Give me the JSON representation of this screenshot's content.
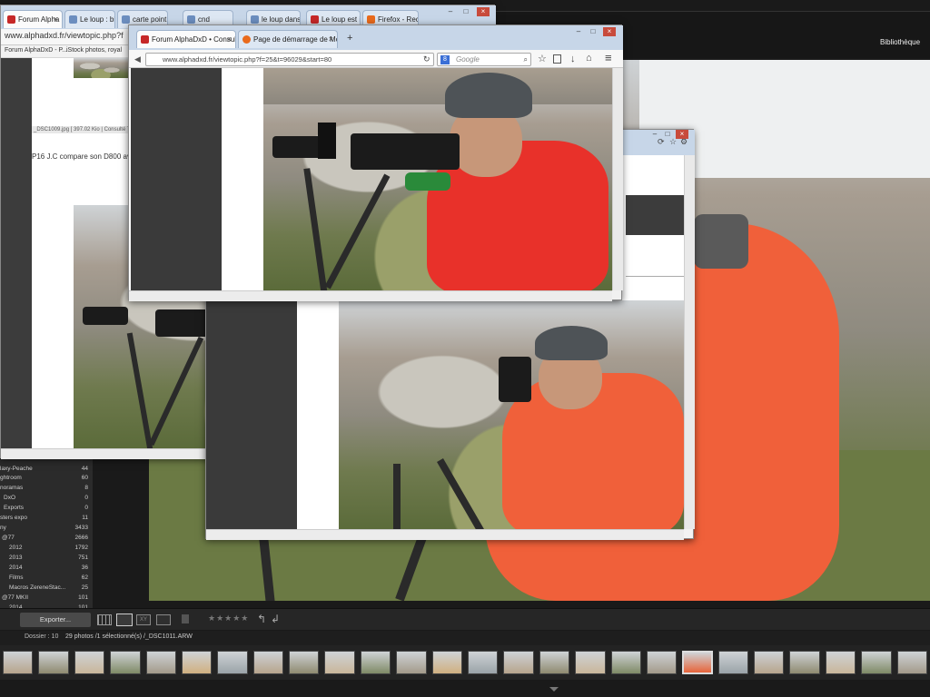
{
  "lightroom": {
    "module_label": "Bibliothèque",
    "export_button": "Exporter...",
    "rating_stars": "★★★★★",
    "source_label": "Dossier : 10",
    "photo_count": "29 photos /1 sélectionné(s) /_DSC1011.ARW",
    "folders": [
      {
        "name": "laxy-Peache",
        "count": "44"
      },
      {
        "name": "ghtroom",
        "count": "60"
      },
      {
        "name": "noramas",
        "count": "8"
      },
      {
        "name": "DxO",
        "count": "0"
      },
      {
        "name": "Exports",
        "count": "0"
      },
      {
        "name": "sters expo",
        "count": "11"
      },
      {
        "name": "ny",
        "count": "3433"
      },
      {
        "name": "@77",
        "count": "2666"
      },
      {
        "name": "2012",
        "count": "1792"
      },
      {
        "name": "2013",
        "count": "751"
      },
      {
        "name": "2014",
        "count": "36"
      },
      {
        "name": "Films",
        "count": "62"
      },
      {
        "name": "Macros ZereneStac...",
        "count": "25"
      },
      {
        "name": "@77 MKII",
        "count": "101"
      },
      {
        "name": "2014",
        "count": "101"
      }
    ],
    "filmstrip_count": 26
  },
  "back_browser": {
    "tabs": [
      {
        "label": "Forum Alpha",
        "active": true
      },
      {
        "label": "Le loup : bic"
      },
      {
        "label": "carte point lo"
      },
      {
        "label": "cnd"
      },
      {
        "label": "le loup dans"
      },
      {
        "label": "Le loup est ic"
      },
      {
        "label": "Firefox - Rech"
      }
    ],
    "url": "www.alphadxd.fr/viewtopic.php?f",
    "bookmarks": [
      "Forum AlphaDxD - P...",
      "iStock photos, royal"
    ],
    "caption": "_DSC1009.jpg [ 397.02 Kio | Consulté 7",
    "post_text": "P16 J.C compare son D800 av"
  },
  "front_browser": {
    "tabs": [
      {
        "label": "Forum AlphaDxD • Consult...",
        "active": true
      },
      {
        "label": "Page de démarrage de Mo..."
      }
    ],
    "new_tab": "+",
    "url": "www.alphadxd.fr/viewtopic.php?f=25&t=96029&start=80",
    "search_placeholder": "Google"
  },
  "icons": {
    "close": "×",
    "minimize": "–",
    "maximize": "□",
    "back": "◀",
    "reload": "↻",
    "star": "☆",
    "home": "⌂",
    "menu": "≡",
    "download": "↓"
  }
}
